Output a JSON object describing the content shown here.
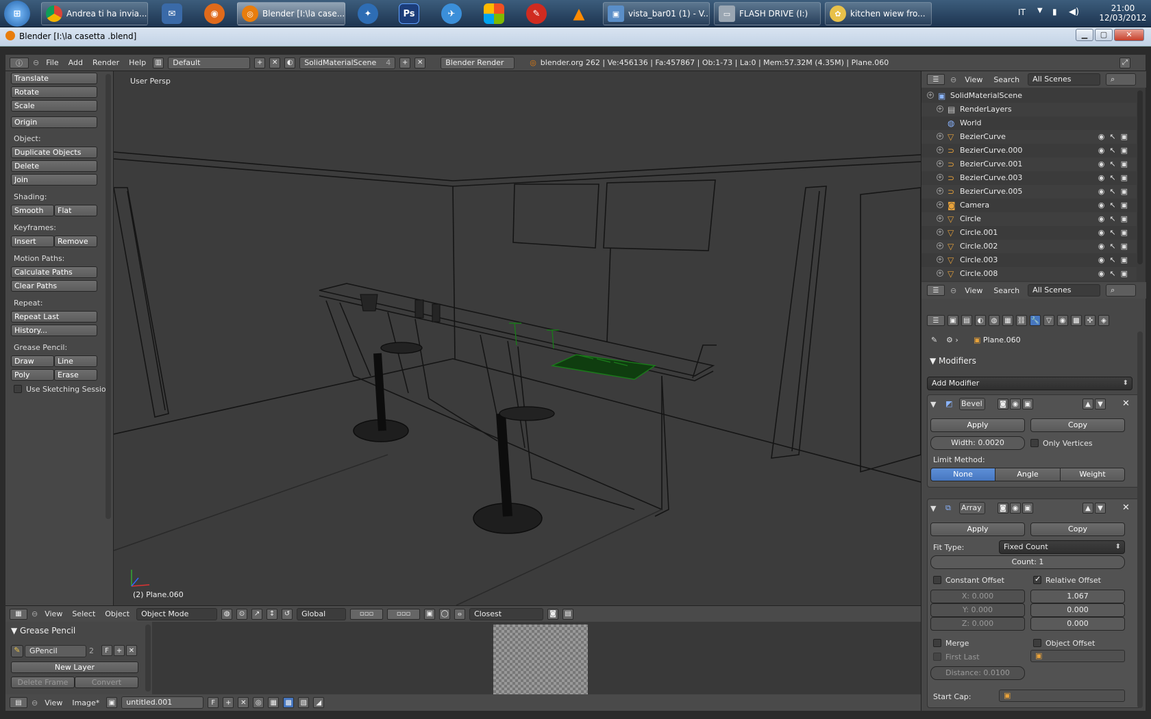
{
  "taskbar": {
    "apps": [
      {
        "label": "Andrea ti ha invia..."
      },
      {
        "label": "Blender [I:\\la case..."
      },
      {
        "label": "vista_bar01 (1) - V..."
      },
      {
        "label": "FLASH DRIVE (I:)"
      },
      {
        "label": "kitchen wiew fro..."
      }
    ],
    "pinned": [
      "Ps"
    ],
    "lang": "IT",
    "time": "21:00",
    "date": "12/03/2012"
  },
  "window": {
    "title": "Blender [I:\\la casetta .blend]"
  },
  "header": {
    "menus": [
      "File",
      "Add",
      "Render",
      "Help"
    ],
    "layout": "Default",
    "scene": "SolidMaterialScene",
    "scene_users": "4",
    "engine": "Blender Render",
    "stats": "blender.org 262 | Ve:456136 | Fa:457867 | Ob:1-73 | La:0 | Mem:57.32M (4.35M) | Plane.060"
  },
  "toolshelf": {
    "translate": "Translate",
    "rotate": "Rotate",
    "scale": "Scale",
    "origin": "Origin",
    "object_label": "Object:",
    "duplicate": "Duplicate Objects",
    "delete": "Delete",
    "join": "Join",
    "shading_label": "Shading:",
    "smooth": "Smooth",
    "flat": "Flat",
    "keyframes_label": "Keyframes:",
    "insert": "Insert",
    "remove": "Remove",
    "motion_label": "Motion Paths:",
    "calc_paths": "Calculate Paths",
    "clear_paths": "Clear Paths",
    "repeat_label": "Repeat:",
    "repeat_last": "Repeat Last",
    "history": "History...",
    "gp_label": "Grease Pencil:",
    "draw": "Draw",
    "line": "Line",
    "poly": "Poly",
    "erase": "Erase",
    "sketching": "Use Sketching Sessio"
  },
  "viewport": {
    "persp": "User Persp",
    "object_info": "(2) Plane.060"
  },
  "view3d_header": {
    "menus": [
      "View",
      "Select",
      "Object"
    ],
    "mode": "Object Mode",
    "orientation": "Global",
    "snap": "Closest"
  },
  "grease_pencil": {
    "title": "Grease Pencil",
    "layer": "GPencil",
    "users": "2",
    "fake": "F",
    "new_layer": "New Layer",
    "delete_frame": "Delete Frame",
    "convert": "Convert"
  },
  "image_header": {
    "menus": [
      "View",
      "Image*"
    ],
    "image_name": "untitled.001",
    "fake": "F"
  },
  "outliner": {
    "menus": [
      "View",
      "Search"
    ],
    "filter": "All Scenes",
    "rows": [
      {
        "name": "SolidMaterialScene"
      },
      {
        "name": "RenderLayers"
      },
      {
        "name": "World"
      },
      {
        "name": "BezierCurve"
      },
      {
        "name": "BezierCurve.000"
      },
      {
        "name": "BezierCurve.001"
      },
      {
        "name": "BezierCurve.003"
      },
      {
        "name": "BezierCurve.005"
      },
      {
        "name": "Camera"
      },
      {
        "name": "Circle"
      },
      {
        "name": "Circle.001"
      },
      {
        "name": "Circle.002"
      },
      {
        "name": "Circle.003"
      },
      {
        "name": "Circle.008"
      }
    ]
  },
  "properties": {
    "menus": [
      "View",
      "Search"
    ],
    "filter": "All Scenes",
    "object": "Plane.060",
    "section": "Modifiers",
    "add_modifier": "Add Modifier",
    "bevel": {
      "name": "Bevel",
      "apply": "Apply",
      "copy": "Copy",
      "width": "Width: 0.0020",
      "only_vertices": "Only Vertices",
      "limit_label": "Limit Method:",
      "limit_options": [
        "None",
        "Angle",
        "Weight"
      ]
    },
    "array": {
      "name": "Array",
      "apply": "Apply",
      "copy": "Copy",
      "fit_label": "Fit Type:",
      "fit_type": "Fixed Count",
      "count": "Count: 1",
      "constant_offset": "Constant Offset",
      "relative_offset": "Relative Offset",
      "cx": "X: 0.000",
      "cy": "Y: 0.000",
      "cz": "Z: 0.000",
      "rx": "1.067",
      "ry": "0.000",
      "rz": "0.000",
      "merge": "Merge",
      "object_offset": "Object Offset",
      "first_last": "First Last",
      "distance": "Distance: 0.0100",
      "start_cap": "Start Cap:"
    }
  }
}
